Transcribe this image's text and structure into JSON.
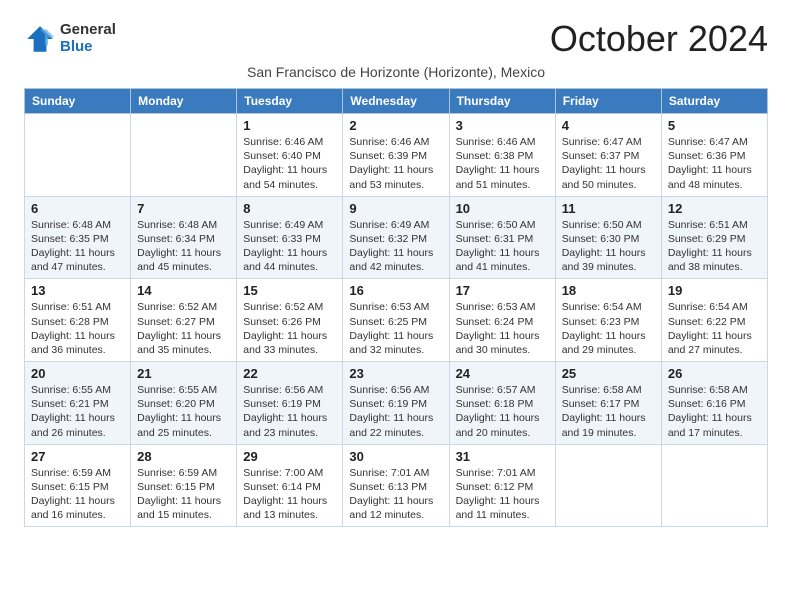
{
  "logo": {
    "general": "General",
    "blue": "Blue"
  },
  "title": "October 2024",
  "subtitle": "San Francisco de Horizonte (Horizonte), Mexico",
  "days_of_week": [
    "Sunday",
    "Monday",
    "Tuesday",
    "Wednesday",
    "Thursday",
    "Friday",
    "Saturday"
  ],
  "weeks": [
    [
      {
        "day": "",
        "sunrise": "",
        "sunset": "",
        "daylight": ""
      },
      {
        "day": "",
        "sunrise": "",
        "sunset": "",
        "daylight": ""
      },
      {
        "day": "1",
        "sunrise": "Sunrise: 6:46 AM",
        "sunset": "Sunset: 6:40 PM",
        "daylight": "Daylight: 11 hours and 54 minutes."
      },
      {
        "day": "2",
        "sunrise": "Sunrise: 6:46 AM",
        "sunset": "Sunset: 6:39 PM",
        "daylight": "Daylight: 11 hours and 53 minutes."
      },
      {
        "day": "3",
        "sunrise": "Sunrise: 6:46 AM",
        "sunset": "Sunset: 6:38 PM",
        "daylight": "Daylight: 11 hours and 51 minutes."
      },
      {
        "day": "4",
        "sunrise": "Sunrise: 6:47 AM",
        "sunset": "Sunset: 6:37 PM",
        "daylight": "Daylight: 11 hours and 50 minutes."
      },
      {
        "day": "5",
        "sunrise": "Sunrise: 6:47 AM",
        "sunset": "Sunset: 6:36 PM",
        "daylight": "Daylight: 11 hours and 48 minutes."
      }
    ],
    [
      {
        "day": "6",
        "sunrise": "Sunrise: 6:48 AM",
        "sunset": "Sunset: 6:35 PM",
        "daylight": "Daylight: 11 hours and 47 minutes."
      },
      {
        "day": "7",
        "sunrise": "Sunrise: 6:48 AM",
        "sunset": "Sunset: 6:34 PM",
        "daylight": "Daylight: 11 hours and 45 minutes."
      },
      {
        "day": "8",
        "sunrise": "Sunrise: 6:49 AM",
        "sunset": "Sunset: 6:33 PM",
        "daylight": "Daylight: 11 hours and 44 minutes."
      },
      {
        "day": "9",
        "sunrise": "Sunrise: 6:49 AM",
        "sunset": "Sunset: 6:32 PM",
        "daylight": "Daylight: 11 hours and 42 minutes."
      },
      {
        "day": "10",
        "sunrise": "Sunrise: 6:50 AM",
        "sunset": "Sunset: 6:31 PM",
        "daylight": "Daylight: 11 hours and 41 minutes."
      },
      {
        "day": "11",
        "sunrise": "Sunrise: 6:50 AM",
        "sunset": "Sunset: 6:30 PM",
        "daylight": "Daylight: 11 hours and 39 minutes."
      },
      {
        "day": "12",
        "sunrise": "Sunrise: 6:51 AM",
        "sunset": "Sunset: 6:29 PM",
        "daylight": "Daylight: 11 hours and 38 minutes."
      }
    ],
    [
      {
        "day": "13",
        "sunrise": "Sunrise: 6:51 AM",
        "sunset": "Sunset: 6:28 PM",
        "daylight": "Daylight: 11 hours and 36 minutes."
      },
      {
        "day": "14",
        "sunrise": "Sunrise: 6:52 AM",
        "sunset": "Sunset: 6:27 PM",
        "daylight": "Daylight: 11 hours and 35 minutes."
      },
      {
        "day": "15",
        "sunrise": "Sunrise: 6:52 AM",
        "sunset": "Sunset: 6:26 PM",
        "daylight": "Daylight: 11 hours and 33 minutes."
      },
      {
        "day": "16",
        "sunrise": "Sunrise: 6:53 AM",
        "sunset": "Sunset: 6:25 PM",
        "daylight": "Daylight: 11 hours and 32 minutes."
      },
      {
        "day": "17",
        "sunrise": "Sunrise: 6:53 AM",
        "sunset": "Sunset: 6:24 PM",
        "daylight": "Daylight: 11 hours and 30 minutes."
      },
      {
        "day": "18",
        "sunrise": "Sunrise: 6:54 AM",
        "sunset": "Sunset: 6:23 PM",
        "daylight": "Daylight: 11 hours and 29 minutes."
      },
      {
        "day": "19",
        "sunrise": "Sunrise: 6:54 AM",
        "sunset": "Sunset: 6:22 PM",
        "daylight": "Daylight: 11 hours and 27 minutes."
      }
    ],
    [
      {
        "day": "20",
        "sunrise": "Sunrise: 6:55 AM",
        "sunset": "Sunset: 6:21 PM",
        "daylight": "Daylight: 11 hours and 26 minutes."
      },
      {
        "day": "21",
        "sunrise": "Sunrise: 6:55 AM",
        "sunset": "Sunset: 6:20 PM",
        "daylight": "Daylight: 11 hours and 25 minutes."
      },
      {
        "day": "22",
        "sunrise": "Sunrise: 6:56 AM",
        "sunset": "Sunset: 6:19 PM",
        "daylight": "Daylight: 11 hours and 23 minutes."
      },
      {
        "day": "23",
        "sunrise": "Sunrise: 6:56 AM",
        "sunset": "Sunset: 6:19 PM",
        "daylight": "Daylight: 11 hours and 22 minutes."
      },
      {
        "day": "24",
        "sunrise": "Sunrise: 6:57 AM",
        "sunset": "Sunset: 6:18 PM",
        "daylight": "Daylight: 11 hours and 20 minutes."
      },
      {
        "day": "25",
        "sunrise": "Sunrise: 6:58 AM",
        "sunset": "Sunset: 6:17 PM",
        "daylight": "Daylight: 11 hours and 19 minutes."
      },
      {
        "day": "26",
        "sunrise": "Sunrise: 6:58 AM",
        "sunset": "Sunset: 6:16 PM",
        "daylight": "Daylight: 11 hours and 17 minutes."
      }
    ],
    [
      {
        "day": "27",
        "sunrise": "Sunrise: 6:59 AM",
        "sunset": "Sunset: 6:15 PM",
        "daylight": "Daylight: 11 hours and 16 minutes."
      },
      {
        "day": "28",
        "sunrise": "Sunrise: 6:59 AM",
        "sunset": "Sunset: 6:15 PM",
        "daylight": "Daylight: 11 hours and 15 minutes."
      },
      {
        "day": "29",
        "sunrise": "Sunrise: 7:00 AM",
        "sunset": "Sunset: 6:14 PM",
        "daylight": "Daylight: 11 hours and 13 minutes."
      },
      {
        "day": "30",
        "sunrise": "Sunrise: 7:01 AM",
        "sunset": "Sunset: 6:13 PM",
        "daylight": "Daylight: 11 hours and 12 minutes."
      },
      {
        "day": "31",
        "sunrise": "Sunrise: 7:01 AM",
        "sunset": "Sunset: 6:12 PM",
        "daylight": "Daylight: 11 hours and 11 minutes."
      },
      {
        "day": "",
        "sunrise": "",
        "sunset": "",
        "daylight": ""
      },
      {
        "day": "",
        "sunrise": "",
        "sunset": "",
        "daylight": ""
      }
    ]
  ]
}
